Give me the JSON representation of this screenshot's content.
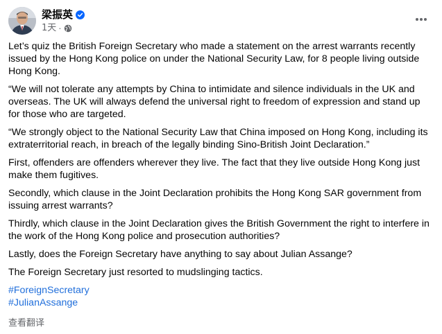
{
  "post": {
    "author": "梁振英",
    "time": "1天",
    "separator": "·",
    "paragraphs": [
      "Let’s quiz the British Foreign Secretary who made a statement on the arrest warrants recently issued by the Hong Kong police on under the National Security Law, for 8 people living outside Hong Kong.",
      "“We will not tolerate any attempts by China to intimidate and silence individuals in the UK and overseas. The UK will always defend the universal right to freedom of expression and stand up for those who are targeted.",
      "“We strongly object to the National Security Law that China imposed on Hong Kong, including its extraterritorial reach, in breach of the legally binding Sino-British Joint Declaration.”",
      "First, offenders are offenders wherever they live. The fact that they live outside Hong Kong just make them fugitives.",
      "Secondly, which clause in the Joint Declaration prohibits the Hong Kong SAR government from issuing arrest warrants?",
      "Thirdly, which clause in the Joint Declaration gives the British Government the right to interfere in the work of the Hong Kong police and prosecution authorities?",
      "Lastly, does the Foreign Secretary have anything to say about Julian Assange?",
      "The Foreign Secretary just resorted to mudslinging tactics."
    ],
    "hashtags": [
      "#ForeignSecretary",
      "#JulianAssange"
    ],
    "translate_label": "查看翻译"
  },
  "icons": {
    "verified": "verified-badge-icon",
    "audience": "globe-icon",
    "more": "more-options-icon"
  },
  "colors": {
    "link": "#216fdb",
    "verified": "#0866ff",
    "secondary_text": "#65676b"
  }
}
